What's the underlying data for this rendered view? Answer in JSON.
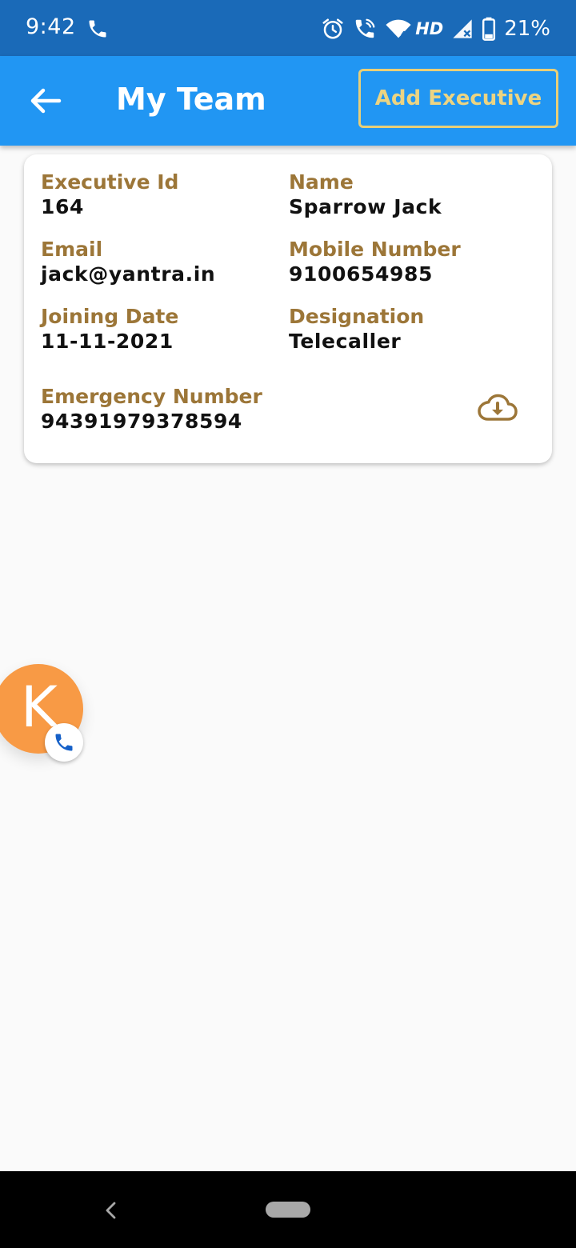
{
  "status_bar": {
    "time": "9:42",
    "network_label": "HD",
    "battery": "21%",
    "icons": [
      "phone-call-icon",
      "alarm-icon",
      "wifi-call-icon",
      "wifi-icon",
      "signal-icon",
      "battery-icon"
    ]
  },
  "app_bar": {
    "title": "My Team",
    "add_button_label": "Add Executive",
    "back_icon": "arrow-left-icon"
  },
  "executive_card": {
    "fields": [
      {
        "label": "Executive Id",
        "value": "164"
      },
      {
        "label": "Name",
        "value": "Sparrow Jack"
      },
      {
        "label": "Email",
        "value": "jack@yantra.in"
      },
      {
        "label": "Mobile Number",
        "value": "9100654985"
      },
      {
        "label": "Joining Date",
        "value": "11-11-2021"
      },
      {
        "label": "Designation",
        "value": "Telecaller"
      },
      {
        "label": "Emergency Number",
        "value": "94391979378594"
      }
    ],
    "download_icon": "cloud-download-icon"
  },
  "chat_head": {
    "letter": "K",
    "badge_icon": "phone-icon"
  },
  "colors": {
    "status_bar": "#1a6ab8",
    "app_bar": "#2196f3",
    "label": "#9c7638",
    "button_border": "#e8cf78",
    "chat_head": "#f89a45",
    "background": "#fafafa"
  }
}
